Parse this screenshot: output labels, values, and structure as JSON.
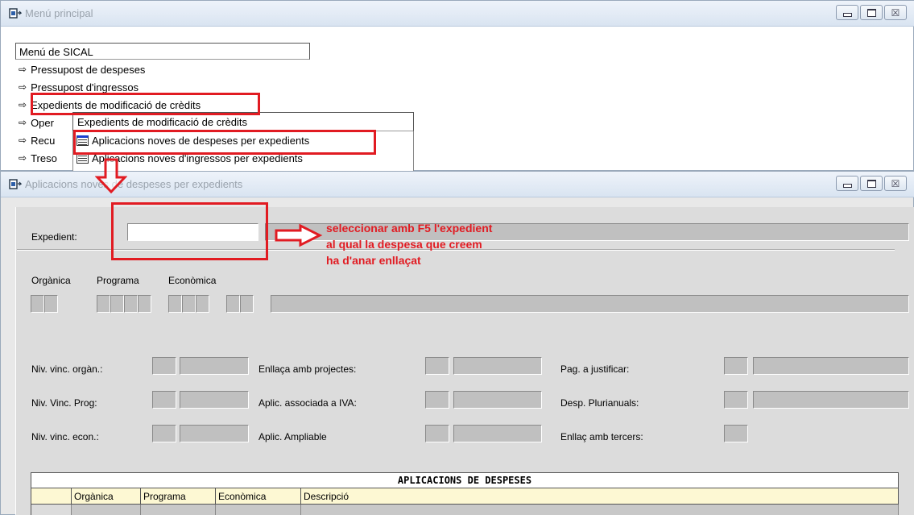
{
  "main_window": {
    "title": "Menú principal",
    "menu_header": "Menú de SICAL",
    "menu_items": [
      {
        "label": "Pressupost de despeses"
      },
      {
        "label": "Pressupost d'ingressos"
      },
      {
        "label": "Expedients de modificació de crèdits"
      },
      {
        "label": "Oper"
      },
      {
        "label": "Recu"
      },
      {
        "label": "Treso"
      }
    ],
    "submenu": {
      "header": "Expedients de modificació de crèdits",
      "items": [
        {
          "label": "Aplicacions noves de despeses per expedients"
        },
        {
          "label": "Aplicacions noves d'ingressos per expedients"
        }
      ]
    }
  },
  "form_window": {
    "title": "Aplicacions noves de despeses per expedients",
    "expedient_label": "Expedient:",
    "expedient_value": "",
    "annotation": {
      "line1": "seleccionar amb F5 l'expedient",
      "line2": "al qual la despesa que creem",
      "line3": "ha d'anar enllaçat"
    },
    "code_labels": {
      "organica": "Orgànica",
      "programa": "Programa",
      "economica": "Econòmica"
    },
    "fields": {
      "niv_vinc_organ": "Niv. vinc. orgàn.:",
      "niv_vinc_prog": "Niv. Vinc. Prog:",
      "niv_vinc_econ": "Niv. vinc. econ.:",
      "enllaca_projectes": "Enllaça amb projectes:",
      "aplic_iva": "Aplic. associada a IVA:",
      "aplic_ampliable": "Aplic. Ampliable",
      "pag_justificar": "Pag. a justificar:",
      "desp_plurianuals": "Desp. Plurianuals:",
      "enllac_tercers": "Enllaç amb tercers:"
    },
    "table": {
      "title": "APLICACIONS DE DESPESES",
      "columns": [
        "",
        "Orgànica",
        "Programa",
        "Econòmica",
        "Descripció"
      ]
    }
  },
  "colors": {
    "annotation": "#e11b22",
    "form_bg": "#dcdcdc",
    "table_header_bg": "#fdf8d3"
  }
}
